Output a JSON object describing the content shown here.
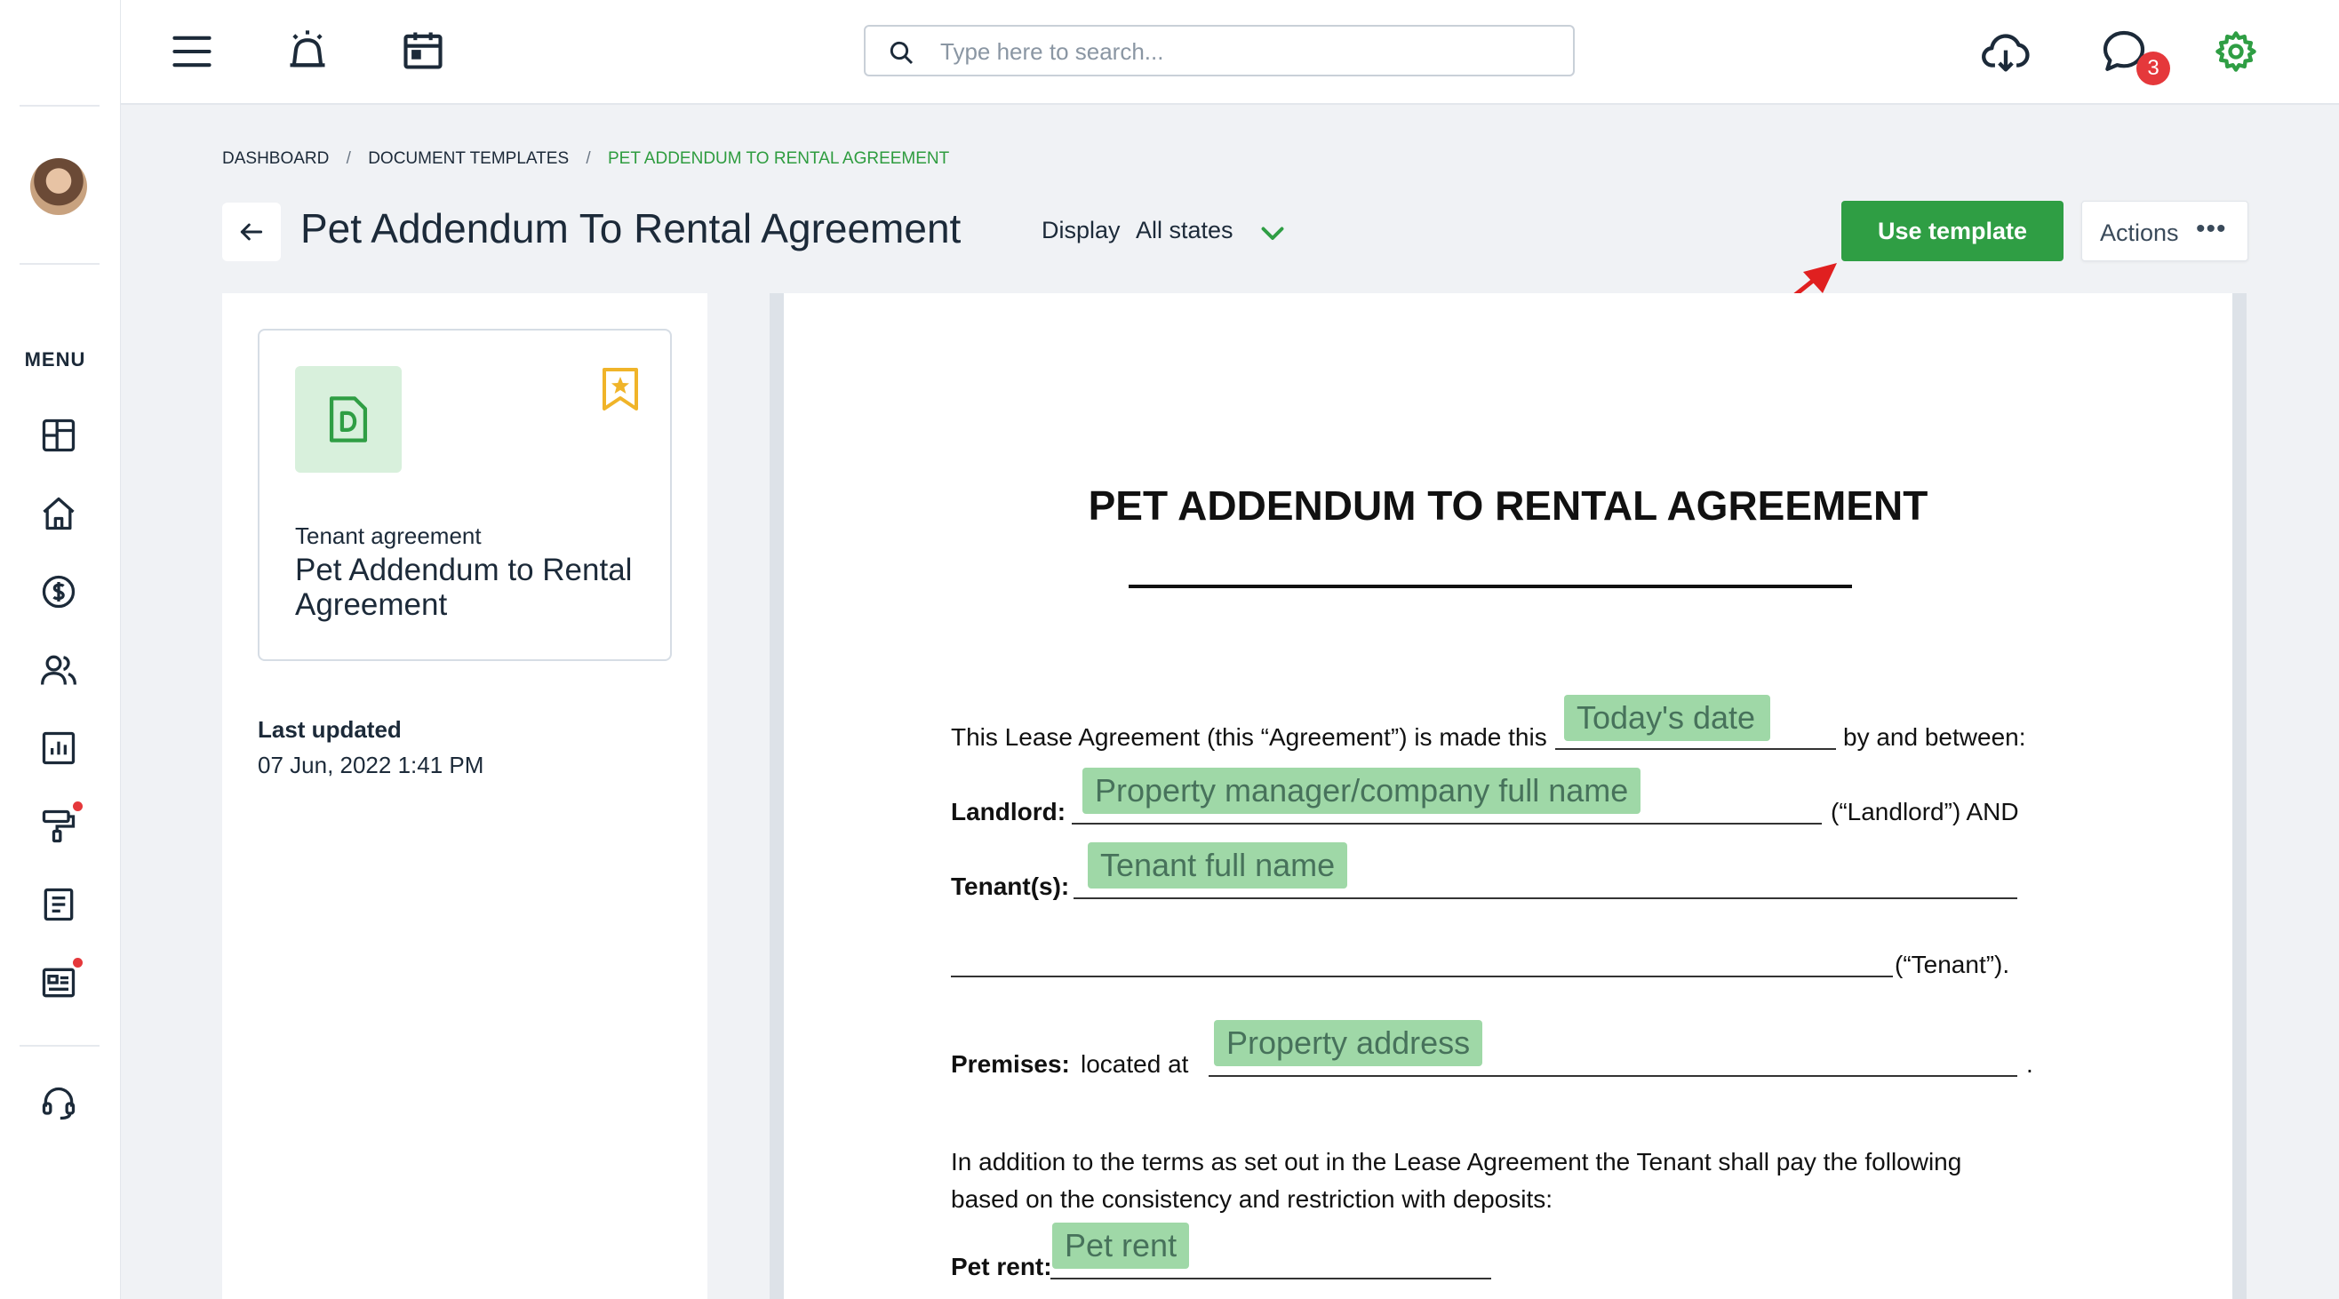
{
  "header": {
    "search_placeholder": "Type here to search...",
    "notification_count": "3"
  },
  "sidebar": {
    "menu_label": "MENU",
    "items": [
      {
        "icon": "dashboard-icon"
      },
      {
        "icon": "home-icon"
      },
      {
        "icon": "dollar-icon"
      },
      {
        "icon": "people-icon"
      },
      {
        "icon": "reports-icon"
      },
      {
        "icon": "maintenance-icon"
      },
      {
        "icon": "document-icon"
      },
      {
        "icon": "listing-icon"
      },
      {
        "icon": "support-icon"
      }
    ]
  },
  "breadcrumb": {
    "items": [
      "DASHBOARD",
      "DOCUMENT TEMPLATES",
      "PET ADDENDUM TO RENTAL AGREEMENT"
    ],
    "separator": "/"
  },
  "page": {
    "title": "Pet Addendum To Rental Agreement",
    "display_label": "Display",
    "display_value": "All states",
    "use_template_label": "Use template",
    "actions_label": "Actions"
  },
  "template_card": {
    "category": "Tenant agreement",
    "name": "Pet Addendum to Rental Agreement",
    "last_updated_label": "Last updated",
    "last_updated_value": "07 Jun, 2022 1:41 PM"
  },
  "document": {
    "title": "PET ADDENDUM TO RENTAL AGREEMENT",
    "intro_text": "This Lease Agreement (this “Agreement”) is made this",
    "intro_tail": "by and between:",
    "landlord_label": "Landlord:",
    "landlord_tail": "(“Landlord”) AND",
    "tenant_label": "Tenant(s):",
    "tenant_tail": "(“Tenant”).",
    "premises_label": "Premises:",
    "premises_text": "located at",
    "premises_tail": ".",
    "terms_line1": "In addition to the terms as set out in the Lease Agreement the Tenant shall pay the following",
    "terms_line2": "based on the consistency and restriction with deposits:",
    "pet_rent_label": "Pet rent:",
    "fields": {
      "todays_date": "Today's date",
      "manager_name": "Property manager/company full name",
      "tenant_name": "Tenant full name",
      "property_address": "Property address",
      "pet_rent": "Pet rent"
    }
  },
  "colors": {
    "accent": "#2f9e44",
    "field_bg": "#9fd8a7",
    "field_text": "#47725b",
    "badge": "#e5383b",
    "bookmark": "#f0b429",
    "annotation_arrow": "#e02020"
  }
}
